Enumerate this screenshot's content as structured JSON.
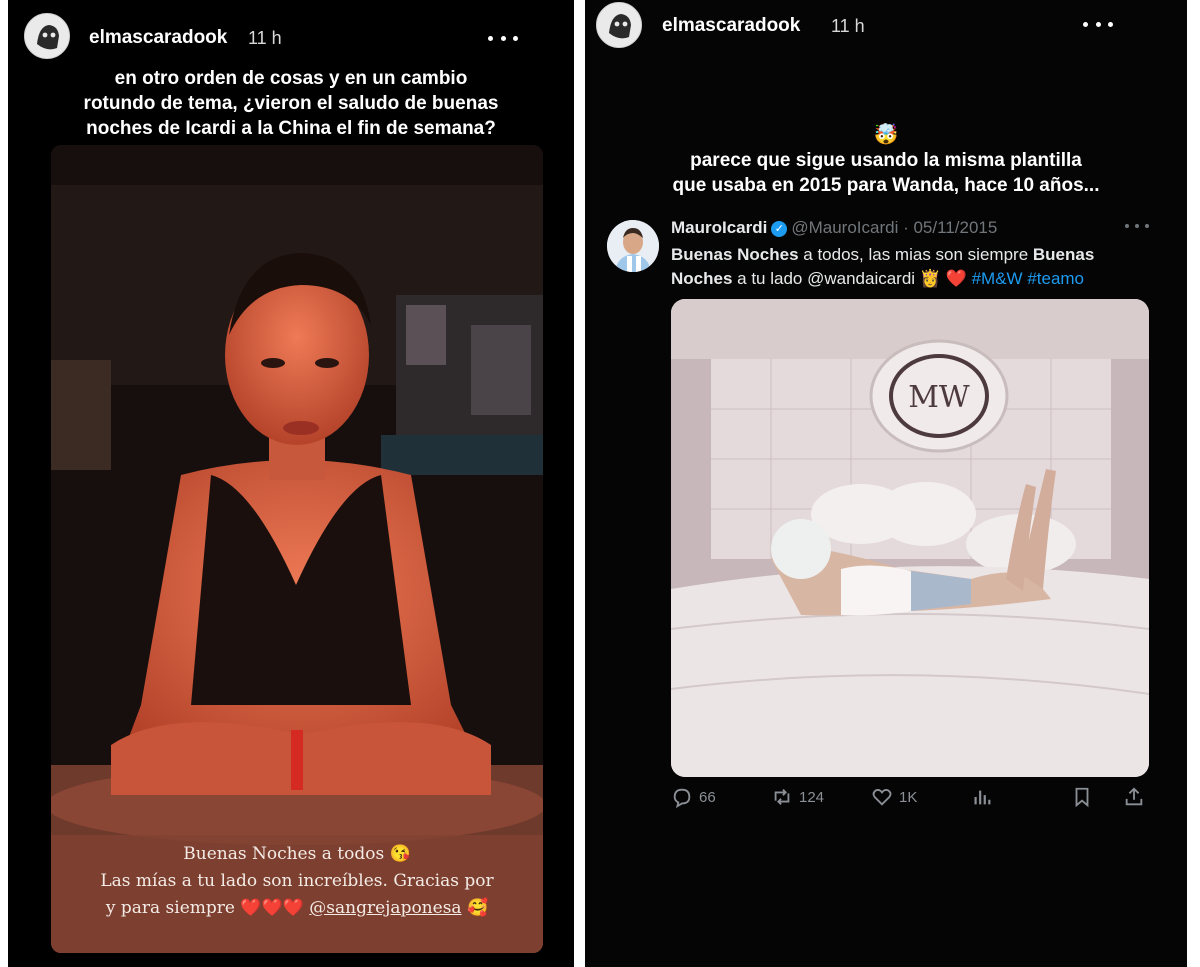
{
  "left_story": {
    "username": "elmascaradook",
    "time": "11 h",
    "caption_lines": [
      "en otro orden de cosas y en un cambio",
      "rotundo de tema, ¿vieron el saludo de buenas",
      "noches de Icardi a la China el fin de semana?"
    ],
    "photo_caption": {
      "line1": "Buenas Noches a todos 😘",
      "line2": "Las mías a tu lado son increíbles. Gracias por",
      "line3_prefix": "y para siempre",
      "line3_hearts": "❤️❤️❤️",
      "mention": "@sangrejaponesa",
      "line3_emoji": "🥰"
    }
  },
  "right_story": {
    "username": "elmascaradook",
    "time": "11 h",
    "emoji": "🤯",
    "caption_lines": [
      "parece que sigue usando la misma plantilla",
      "que usaba en 2015 para Wanda, hace 10 años..."
    ],
    "tweet": {
      "name": "MauroIcardi",
      "handle_date": "@MauroIcardi · 05/11/2015",
      "text_line1_bold1": "Buenas Noches",
      "text_line1_rest": " a todos, las mias son siempre ",
      "text_line1_bold2": "Buenas",
      "text_line2_bold": "Noches",
      "text_line2_rest": " a tu lado @wandaicardi 👸 ❤️ ",
      "hashtag1": "#M&W",
      "hashtag2": "#teamo",
      "monogram": "MW",
      "replies": "66",
      "retweets": "124",
      "likes": "1K"
    }
  },
  "colors": {
    "background": "#000000",
    "link_blue": "#1d9bf0",
    "muted_gray": "#71767b",
    "caption_overlay": "#82422f"
  }
}
